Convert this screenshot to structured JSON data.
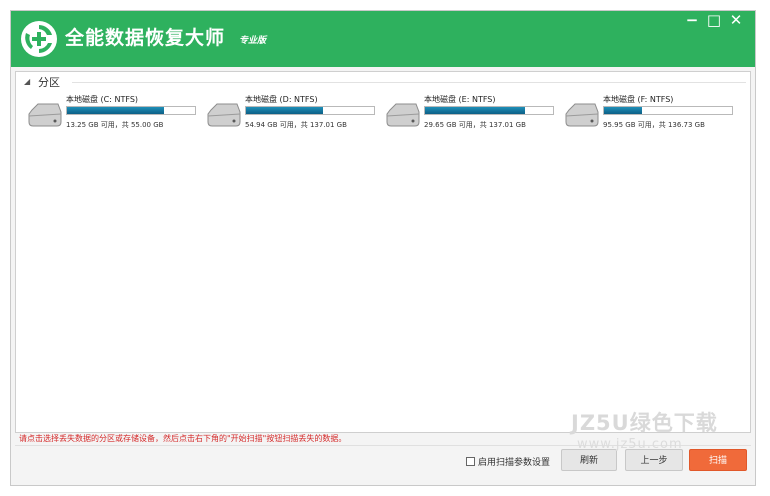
{
  "app": {
    "title": "全能数据恢复大师",
    "edition": "专业版",
    "controls": {
      "minimize": "−",
      "maximize": "□",
      "close": "✕"
    }
  },
  "section": {
    "toggle": "◢",
    "label": "分区"
  },
  "disks": [
    {
      "name": "本地磁盘 (C: NTFS)",
      "info": "13.25 GB 可用，共 55.00 GB",
      "used_fraction": 0.76
    },
    {
      "name": "本地磁盘 (D: NTFS)",
      "info": "54.94 GB 可用，共 137.01 GB",
      "used_fraction": 0.6
    },
    {
      "name": "本地磁盘 (E: NTFS)",
      "info": "29.65 GB 可用，共 137.01 GB",
      "used_fraction": 0.78
    },
    {
      "name": "本地磁盘 (F: NTFS)",
      "info": "95.95 GB 可用，共 136.73 GB",
      "used_fraction": 0.3
    }
  ],
  "hint": "请点击选择丢失数据的分区或存储设备，然后点击右下角的\"开始扫描\"按钮扫描丢失的数据。",
  "footer": {
    "scan_params_label": "启用扫描参数设置",
    "refresh": "刷新",
    "previous": "上一步",
    "scan": "扫描"
  },
  "watermark": {
    "line1": "JZ5U绿色下载",
    "line2": "www.jz5u.com"
  },
  "colors": {
    "titlebar": "#2eb15e",
    "bar_fill": "#0c6f98",
    "accent_button": "#f06a3a",
    "hint_text": "#d52b2b"
  },
  "icons": {
    "logo": "recycle-plus-icon",
    "disk": "hard-drive-icon"
  }
}
